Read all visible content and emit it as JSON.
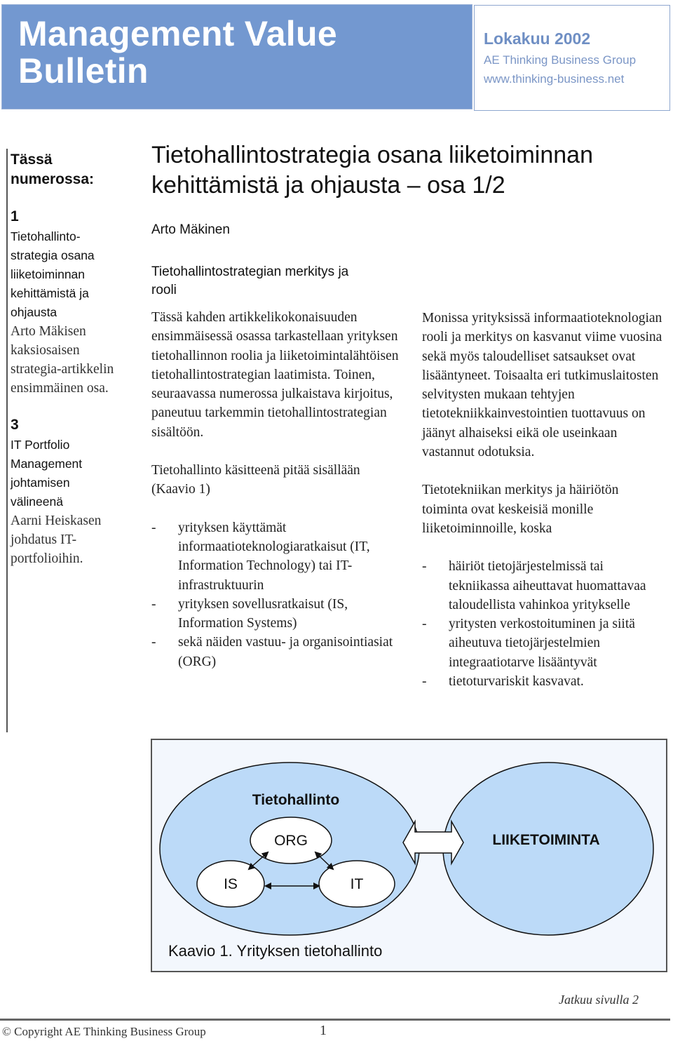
{
  "masthead": {
    "title_line1": "Management Value",
    "title_line2": "Bulletin",
    "issue_month": "Lokakuu 2002",
    "organization": "AE Thinking Business Group",
    "website": "www.thinking-business.net",
    "colors": {
      "banner": "#7398d0",
      "info_text": "#7b96c6"
    }
  },
  "sidebar": {
    "heading_line1": "Tässä",
    "heading_line2": "numerossa:",
    "items": [
      {
        "page": "1",
        "title_lines": [
          "Tietohallinto-",
          "strategia osana",
          "liiketoiminnan",
          "kehittämistä ja",
          "ohjausta"
        ],
        "description_lines": [
          "Arto Mäkisen",
          "kaksiosaisen",
          "strategia-artikkelin",
          "ensimmäinen osa."
        ]
      },
      {
        "page": "3",
        "title_lines": [
          "IT Portfolio",
          "Management",
          "johtamisen",
          "välineenä"
        ],
        "description_lines": [
          "Aarni Heiskasen",
          "johdatus IT-",
          "portfolioihin."
        ]
      }
    ]
  },
  "article": {
    "title_line1": "Tietohallintostrategia osana liiketoiminnan",
    "title_line2": "kehittämistä ja ohjausta – osa 1/2",
    "author": "Arto Mäkinen",
    "section_heading_line1": "Tietohallintostrategian merkitys ja",
    "section_heading_line2": "rooli",
    "column1": {
      "intro": "Tässä kahden artikkelikokonaisuuden ensimmäisessä osassa tarkastellaan yrityksen tietohallinnon roolia ja liiketoimintalähtöisen tietohallintostrategian laatimista. Toinen, seuraavassa numerossa julkaistava kirjoitus, paneutuu tarkemmin tietohallintostrategian sisältöön.",
      "lead": "Tietohallinto käsitteenä pitää sisällään (Kaavio 1)",
      "bullets": [
        "yrityksen käyttämät informaatioteknologiaratkaisut (IT, Information Technology) tai IT-infrastruktuurin",
        "yrityksen sovellusratkaisut (IS, Information Systems)",
        "sekä näiden vastuu- ja organisointiasiat  (ORG)"
      ]
    },
    "column2": {
      "intro": "Monissa yrityksissä informaatioteknologian rooli ja merkitys on kasvanut viime vuosina sekä myös taloudelliset satsaukset ovat lisääntyneet. Toisaalta eri tutkimuslaitosten selvitysten mukaan tehtyjen tietotekniikkainvestointien tuottavuus on jäänyt alhaiseksi eikä ole useinkaan vastannut odotuksia.",
      "lead": "Tietotekniikan merkitys ja häiriötön toiminta ovat keskeisiä monille liiketoiminnoille, koska",
      "bullets": [
        "häiriöt  tietojärjestelmissä tai tekniikassa aiheuttavat huomattavaa taloudellista vahinkoa yritykselle",
        "yritysten verkostoituminen ja siitä aiheutuva tietojärjestelmien integraatiotarve lisääntyvät",
        "tietoturvariskit kasvavat."
      ]
    },
    "bullet_marker": "-"
  },
  "figure": {
    "left_ellipse_label": "Tietohallinto",
    "right_ellipse_label": "LIIKETOIMINTA",
    "nodes": [
      "ORG",
      "IS",
      "IT"
    ],
    "caption": "Kaavio 1. Yrityksen tietohallinto",
    "colors": {
      "background": "#f3f7fd",
      "ellipse_fill": "#bcdaf8",
      "node_fill": "#ffffff"
    }
  },
  "footer": {
    "continued": "Jatkuu sivulla 2",
    "copyright": "© Copyright AE Thinking Business Group",
    "page_number": "1"
  }
}
